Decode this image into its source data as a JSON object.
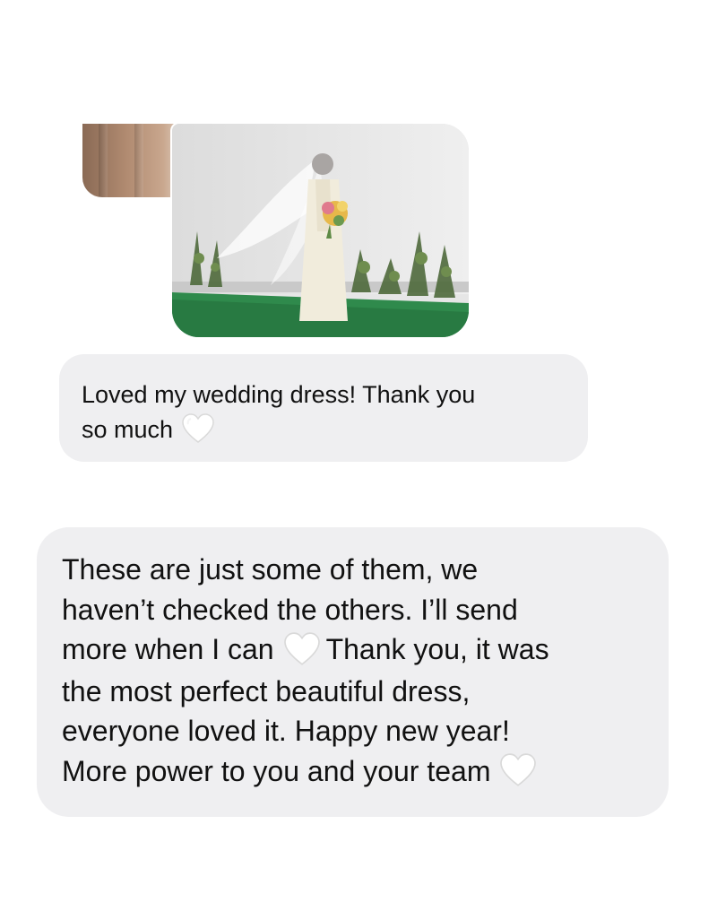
{
  "conversation": {
    "photos": [
      {
        "icon": "photo-fabric-thumbnail"
      },
      {
        "icon": "photo-bride-in-wedding-dress"
      }
    ],
    "messages": [
      {
        "lines": [
          "Loved my wedding dress! Thank you",
          "so much"
        ],
        "trailing_icon": "white-heart-icon"
      },
      {
        "lines": [
          "These are just some of them, we",
          "haven’t checked the others. I’ll send",
          "more when I can",
          "Thank you, it was",
          "the most perfect beautiful dress,",
          "everyone loved it. Happy new year!",
          "More power to you and your team"
        ],
        "inline_icon": "white-heart-icon",
        "trailing_icon": "white-heart-icon"
      }
    ]
  },
  "colors": {
    "bubble_background": "#efeff1",
    "text": "#111111",
    "page_background": "#ffffff"
  }
}
